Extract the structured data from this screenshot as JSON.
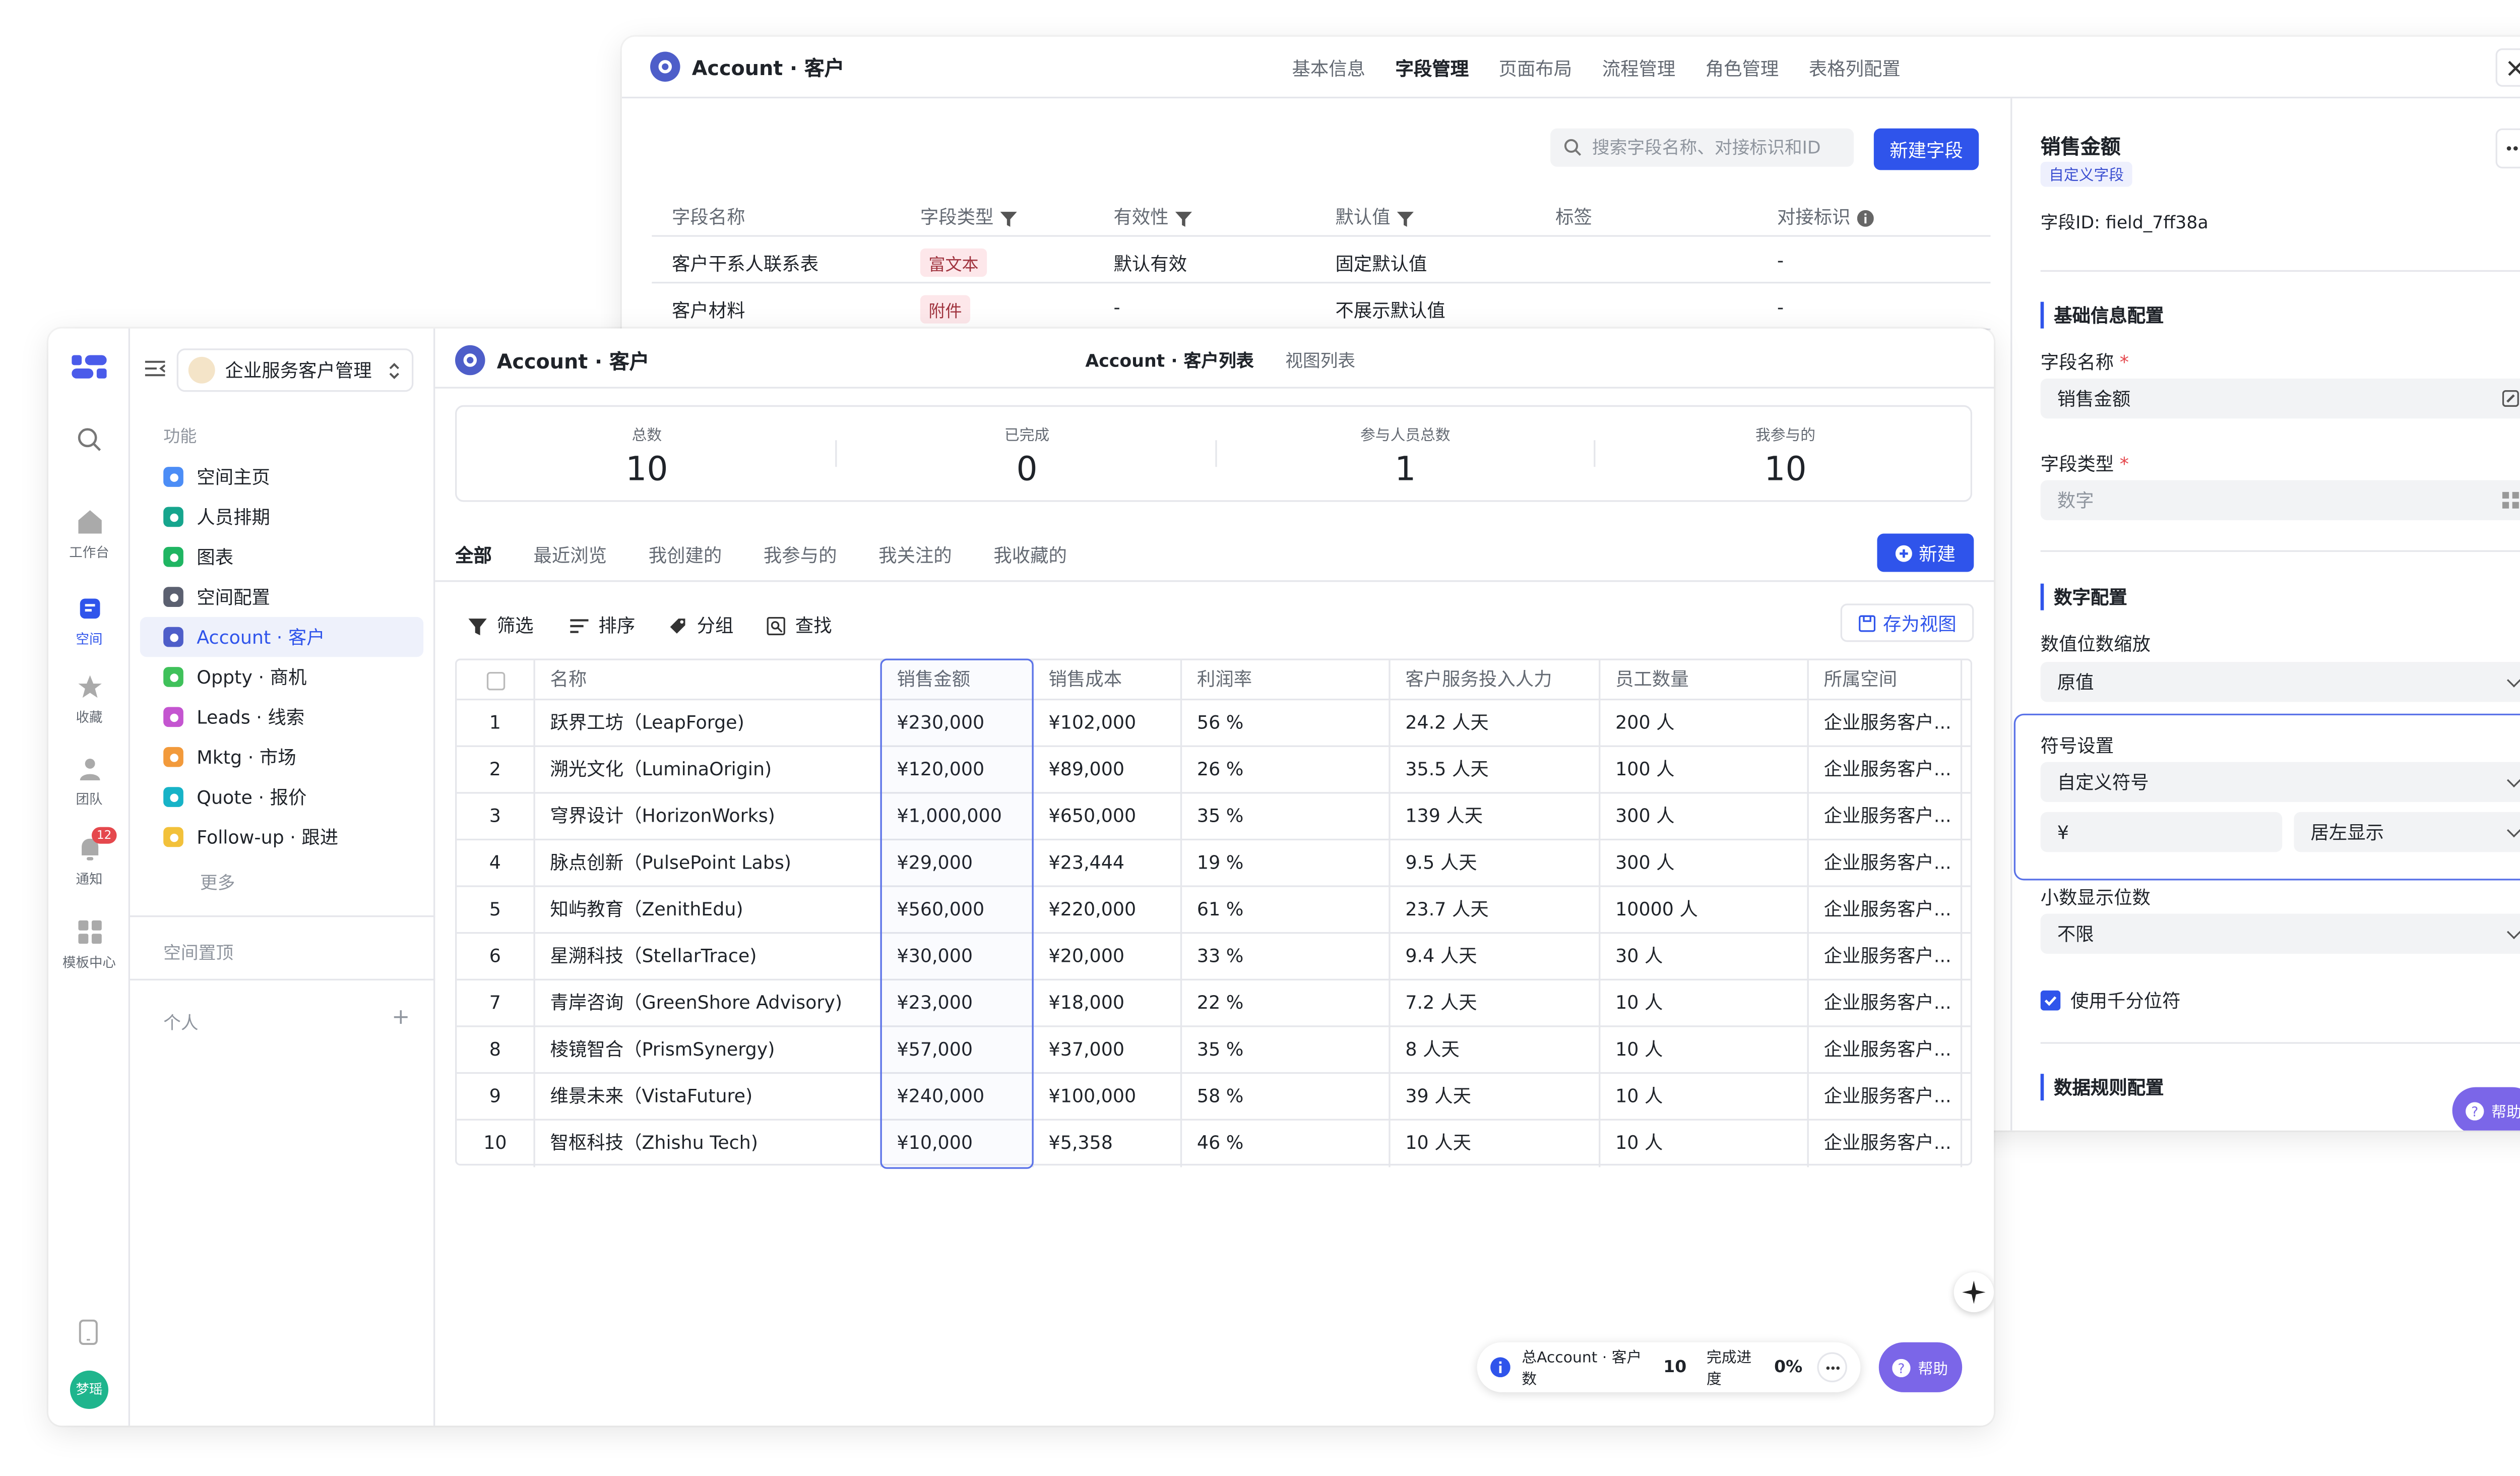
{
  "colors": {
    "primary": "#2f54eb",
    "help": "#7b66e8",
    "badge": "#e5484d"
  },
  "back_window": {
    "app_title": "Account · 客户",
    "tabs": [
      "基本信息",
      "字段管理",
      "页面布局",
      "流程管理",
      "角色管理",
      "表格列配置"
    ],
    "active_tab": 1,
    "search_placeholder": "搜索字段名称、对接标识和ID",
    "new_field_label": "新建字段",
    "columns": [
      "字段名称",
      "字段类型",
      "有效性",
      "默认值",
      "标签",
      "对接标识"
    ],
    "rows": [
      {
        "name": "客户干系人联系表",
        "type": "富文本",
        "validity": "默认有效",
        "default": "固定默认值",
        "tag": "",
        "api": "-"
      },
      {
        "name": "客户材料",
        "type": "附件",
        "validity": "-",
        "default": "不展示默认值",
        "tag": "",
        "api": "-"
      }
    ]
  },
  "panel": {
    "title": "销售金额",
    "badge": "自定义字段",
    "field_id": "字段ID:  field_7ff38a",
    "basic_section": "基础信息配置",
    "name_label": "字段名称",
    "name_value": "销售金额",
    "type_label": "字段类型",
    "type_value": "数字",
    "number_section": "数字配置",
    "scale_label": "数值位数缩放",
    "scale_value": "原值",
    "symbol_label": "符号设置",
    "symbol_mode": "自定义符号",
    "symbol_value": "¥",
    "symbol_pos": "居左显示",
    "decimal_label": "小数显示位数",
    "decimal_value": "不限",
    "thousands_label": "使用千分位符",
    "rules_section": "数据规则配置",
    "help_label": "帮助"
  },
  "rail": {
    "items": [
      "工作台",
      "空间",
      "收藏",
      "团队",
      "通知",
      "模板中心"
    ],
    "notify_count": "12",
    "avatar_text": "梦瑶"
  },
  "sidebar": {
    "workspace": "企业服务客户管理",
    "section_func": "功能",
    "items": [
      {
        "label": "空间主页",
        "color": "#4c8df6"
      },
      {
        "label": "人员排期",
        "color": "#16a58d"
      },
      {
        "label": "图表",
        "color": "#1fb562"
      },
      {
        "label": "空间配置",
        "color": "#5b6070"
      },
      {
        "label": "Account · 客户",
        "color": "#4e5ec9"
      },
      {
        "label": "Oppty · 商机",
        "color": "#3fc15a"
      },
      {
        "label": "Leads · 线索",
        "color": "#c455d0"
      },
      {
        "label": "Mktg · 市场",
        "color": "#f29a3b"
      },
      {
        "label": "Quote · 报价",
        "color": "#17b3c7"
      },
      {
        "label": "Follow-up · 跟进",
        "color": "#f2c13a"
      }
    ],
    "more": "更多",
    "pinned": "空间置顶",
    "personal": "个人"
  },
  "main": {
    "title": "Account · 客户",
    "view_tabs": [
      "Account · 客户列表",
      "视图列表"
    ],
    "stats": [
      {
        "label": "总数",
        "value": "10"
      },
      {
        "label": "已完成",
        "value": "0"
      },
      {
        "label": "参与人员总数",
        "value": "1"
      },
      {
        "label": "我参与的",
        "value": "10"
      }
    ],
    "filter_tabs": [
      "全部",
      "最近浏览",
      "我创建的",
      "我参与的",
      "我关注的",
      "我收藏的"
    ],
    "new_label": "新建",
    "toolbar": [
      "筛选",
      "排序",
      "分组",
      "查找"
    ],
    "save_view": "存为视图",
    "columns": [
      "名称",
      "销售金额",
      "销售成本",
      "利润率",
      "客户服务投入人力",
      "员工数量",
      "所属空间"
    ],
    "rows": [
      {
        "idx": "1",
        "name": "跃界工坊（LeapForge)",
        "sales": "¥230,000",
        "cost": "¥102,000",
        "margin": "56 %",
        "effort": "24.2 人天",
        "staff": "200 人",
        "space": "企业服务客户..."
      },
      {
        "idx": "2",
        "name": "溯光文化（LuminaOrigin)",
        "sales": "¥120,000",
        "cost": "¥89,000",
        "margin": "26 %",
        "effort": "35.5 人天",
        "staff": "100 人",
        "space": "企业服务客户..."
      },
      {
        "idx": "3",
        "name": "穹界设计（HorizonWorks)",
        "sales": "¥1,000,000",
        "cost": "¥650,000",
        "margin": "35 %",
        "effort": "139 人天",
        "staff": "300 人",
        "space": "企业服务客户..."
      },
      {
        "idx": "4",
        "name": "脉点创新（PulsePoint Labs)",
        "sales": "¥29,000",
        "cost": "¥23,444",
        "margin": "19 %",
        "effort": "9.5 人天",
        "staff": "300 人",
        "space": "企业服务客户..."
      },
      {
        "idx": "5",
        "name": "知屿教育（ZenithEdu)",
        "sales": "¥560,000",
        "cost": "¥220,000",
        "margin": "61 %",
        "effort": "23.7 人天",
        "staff": "10000 人",
        "space": "企业服务客户..."
      },
      {
        "idx": "6",
        "name": "星溯科技（StellarTrace)",
        "sales": "¥30,000",
        "cost": "¥20,000",
        "margin": "33 %",
        "effort": "9.4 人天",
        "staff": "30 人",
        "space": "企业服务客户..."
      },
      {
        "idx": "7",
        "name": "青岸咨询（GreenShore Advisory)",
        "sales": "¥23,000",
        "cost": "¥18,000",
        "margin": "22 %",
        "effort": "7.2 人天",
        "staff": "10 人",
        "space": "企业服务客户..."
      },
      {
        "idx": "8",
        "name": "棱镜智合（PrismSynergy)",
        "sales": "¥57,000",
        "cost": "¥37,000",
        "margin": "35 %",
        "effort": "8 人天",
        "staff": "10 人",
        "space": "企业服务客户..."
      },
      {
        "idx": "9",
        "name": "维景未来（VistaFuture)",
        "sales": "¥240,000",
        "cost": "¥100,000",
        "margin": "58 %",
        "effort": "39 人天",
        "staff": "10 人",
        "space": "企业服务客户..."
      },
      {
        "idx": "10",
        "name": "智枢科技（Zhishu Tech)",
        "sales": "¥10,000",
        "cost": "¥5,358",
        "margin": "46 %",
        "effort": "10 人天",
        "staff": "10 人",
        "space": "企业服务客户..."
      }
    ],
    "footer": {
      "count_label": "总Account · 客户数",
      "count": "10",
      "progress_label": "完成进度",
      "progress": "0%"
    },
    "help_label": "帮助"
  }
}
